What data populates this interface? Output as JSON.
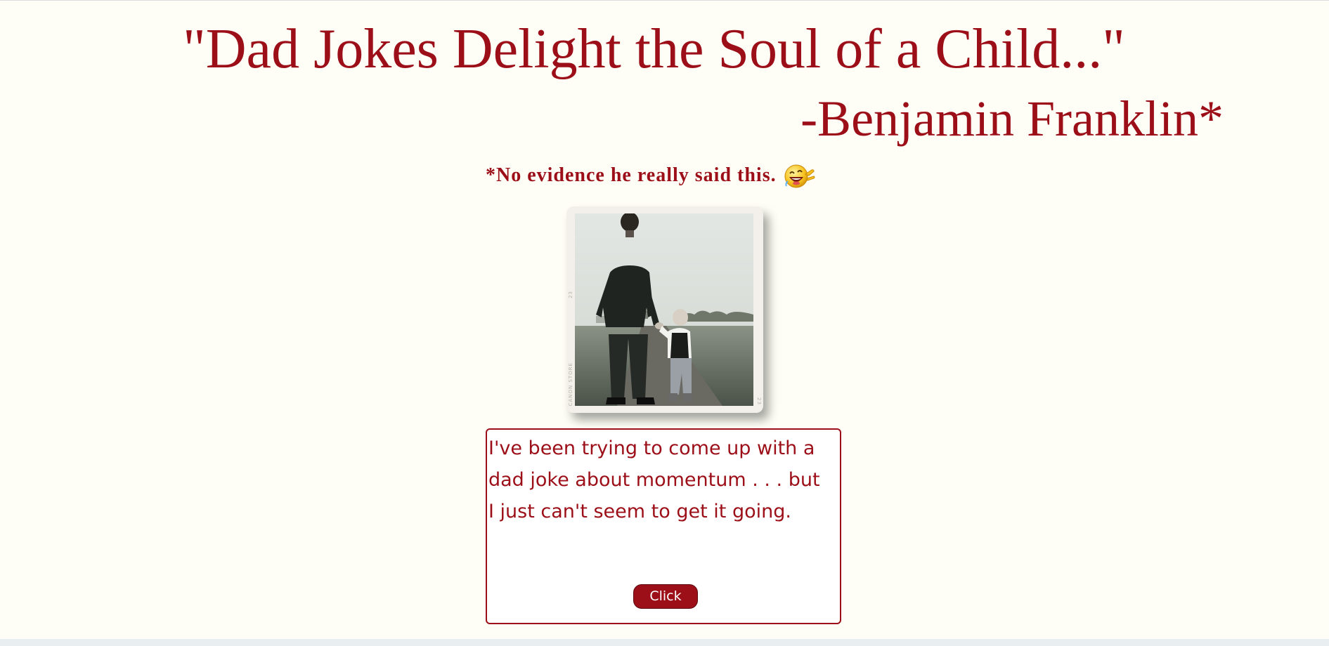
{
  "header": {
    "quote": "\"Dad Jokes Delight the Soul of a Child...\"",
    "attribution": "-Benjamin Franklin*",
    "disclaimer": "*No evidence he really said this."
  },
  "photo": {
    "description_icon": "father-and-child-photo",
    "edge_marks": [
      "CANON STORE",
      "23",
      "23"
    ]
  },
  "joke": {
    "text": "I've been trying to come up with a dad joke about momentum . . . but I just can't seem to get it going.",
    "button_label": "Click"
  },
  "colors": {
    "accent": "#9c0f18",
    "background": "#fefef6"
  }
}
